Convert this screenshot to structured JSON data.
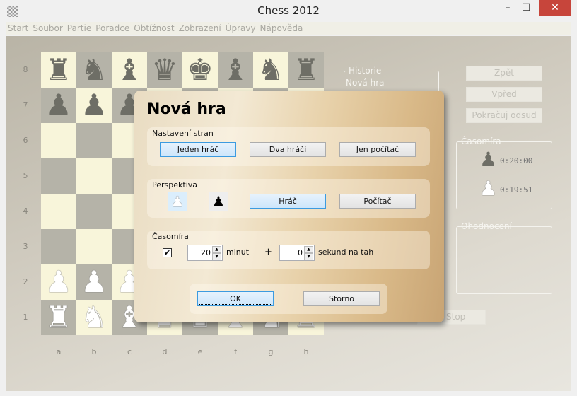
{
  "window": {
    "title": "Chess 2012",
    "minimize": "–",
    "maximize": "☐",
    "close": "✕"
  },
  "menu": [
    "Start",
    "Soubor",
    "Partie",
    "Poradce",
    "Obtížnost",
    "Zobrazení",
    "Úpravy",
    "Nápověda"
  ],
  "board": {
    "ranks": [
      "8",
      "7",
      "6",
      "5",
      "4",
      "3",
      "2",
      "1"
    ],
    "files": [
      "a",
      "b",
      "c",
      "d",
      "e",
      "f",
      "g",
      "h"
    ],
    "position": [
      "rnbqkbnr",
      "pppppppp",
      "........",
      "........",
      "........",
      "........",
      "PPPPPPPP",
      "RNBQKBNR"
    ],
    "colors": {
      "light": "#f8f5da",
      "dark": "#b5b3a8"
    }
  },
  "side": {
    "history_label": "Historie",
    "history_items": [
      "Nová hra"
    ],
    "back": "Zpět",
    "forward": "Vpřed",
    "continue": "Pokračuj odsud",
    "clock_label": "Časomíra",
    "black_time": "0:20:00",
    "white_time": "0:19:51",
    "eval_label": "Ohodnocení",
    "stop": "Stop"
  },
  "dialog": {
    "title": "Nová hra",
    "sides": {
      "label": "Nastavení stran",
      "options": [
        "Jeden hráč",
        "Dva hráči",
        "Jen počítač"
      ],
      "selected": "Jeden hráč"
    },
    "perspective": {
      "label": "Perspektiva",
      "white_icon": "white-pawn",
      "black_icon": "black-pawn",
      "options": [
        "Hráč",
        "Počítač"
      ],
      "selected": "Hráč"
    },
    "clock": {
      "label": "Časomíra",
      "enabled": true,
      "minutes": "20",
      "minutes_label": "minut",
      "plus": "+",
      "seconds": "0",
      "seconds_label": "sekund na tah"
    },
    "ok": "OK",
    "cancel": "Storno"
  }
}
